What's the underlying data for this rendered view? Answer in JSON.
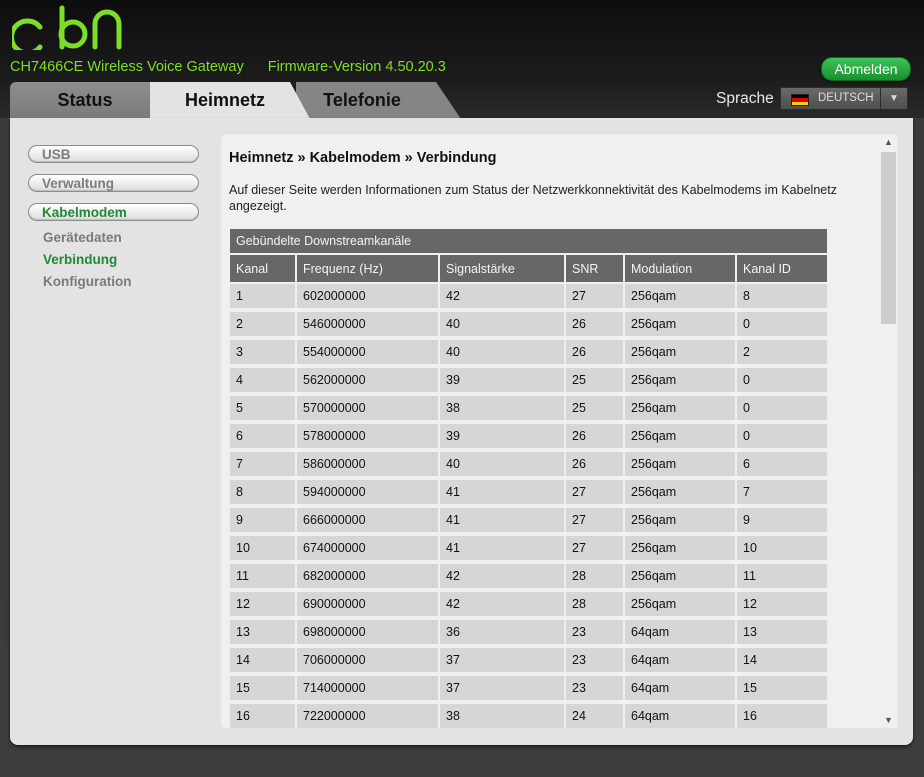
{
  "header": {
    "logo_text": "cbn",
    "model": "CH7466CE  Wireless Voice Gateway",
    "firmware": "Firmware-Version  4.50.20.3",
    "logout_label": "Abmelden"
  },
  "tabs": [
    {
      "label": "Status"
    },
    {
      "label": "Heimnetz"
    },
    {
      "label": "Telefonie"
    }
  ],
  "language": {
    "label": "Sprache",
    "selected": "DEUTSCH",
    "flag_colors": [
      "#000000",
      "#dd0000",
      "#ffce00"
    ]
  },
  "sidebar": {
    "items": [
      {
        "label": "USB"
      },
      {
        "label": "Verwaltung"
      },
      {
        "label": "Kabelmodem"
      }
    ],
    "subitems": [
      {
        "label": "Gerätedaten"
      },
      {
        "label": "Verbindung"
      },
      {
        "label": "Konfiguration"
      }
    ]
  },
  "content": {
    "breadcrumb": "Heimnetz » Kabelmodem » Verbindung",
    "description": "Auf dieser Seite werden Informationen zum Status der Netzwerkkonnektivität des Kabelmodems im Kabelnetz angezeigt.",
    "table_title": "Gebündelte Downstreamkanäle",
    "columns": [
      "Kanal",
      "Frequenz (Hz)",
      "Signalstärke",
      "SNR",
      "Modulation",
      "Kanal ID"
    ],
    "rows": [
      [
        "1",
        "602000000",
        "42",
        "27",
        "256qam",
        "8"
      ],
      [
        "2",
        "546000000",
        "40",
        "26",
        "256qam",
        "0"
      ],
      [
        "3",
        "554000000",
        "40",
        "26",
        "256qam",
        "2"
      ],
      [
        "4",
        "562000000",
        "39",
        "25",
        "256qam",
        "0"
      ],
      [
        "5",
        "570000000",
        "38",
        "25",
        "256qam",
        "0"
      ],
      [
        "6",
        "578000000",
        "39",
        "26",
        "256qam",
        "0"
      ],
      [
        "7",
        "586000000",
        "40",
        "26",
        "256qam",
        "6"
      ],
      [
        "8",
        "594000000",
        "41",
        "27",
        "256qam",
        "7"
      ],
      [
        "9",
        "666000000",
        "41",
        "27",
        "256qam",
        "9"
      ],
      [
        "10",
        "674000000",
        "41",
        "27",
        "256qam",
        "10"
      ],
      [
        "11",
        "682000000",
        "42",
        "28",
        "256qam",
        "11"
      ],
      [
        "12",
        "690000000",
        "42",
        "28",
        "256qam",
        "12"
      ],
      [
        "13",
        "698000000",
        "36",
        "23",
        "64qam",
        "13"
      ],
      [
        "14",
        "706000000",
        "37",
        "23",
        "64qam",
        "14"
      ],
      [
        "15",
        "714000000",
        "37",
        "23",
        "64qam",
        "15"
      ],
      [
        "16",
        "722000000",
        "38",
        "24",
        "64qam",
        "16"
      ]
    ]
  },
  "colors": {
    "brand_green": "#7dde2a",
    "active_green": "#1f8a35",
    "logout_green": "#2aa844"
  }
}
